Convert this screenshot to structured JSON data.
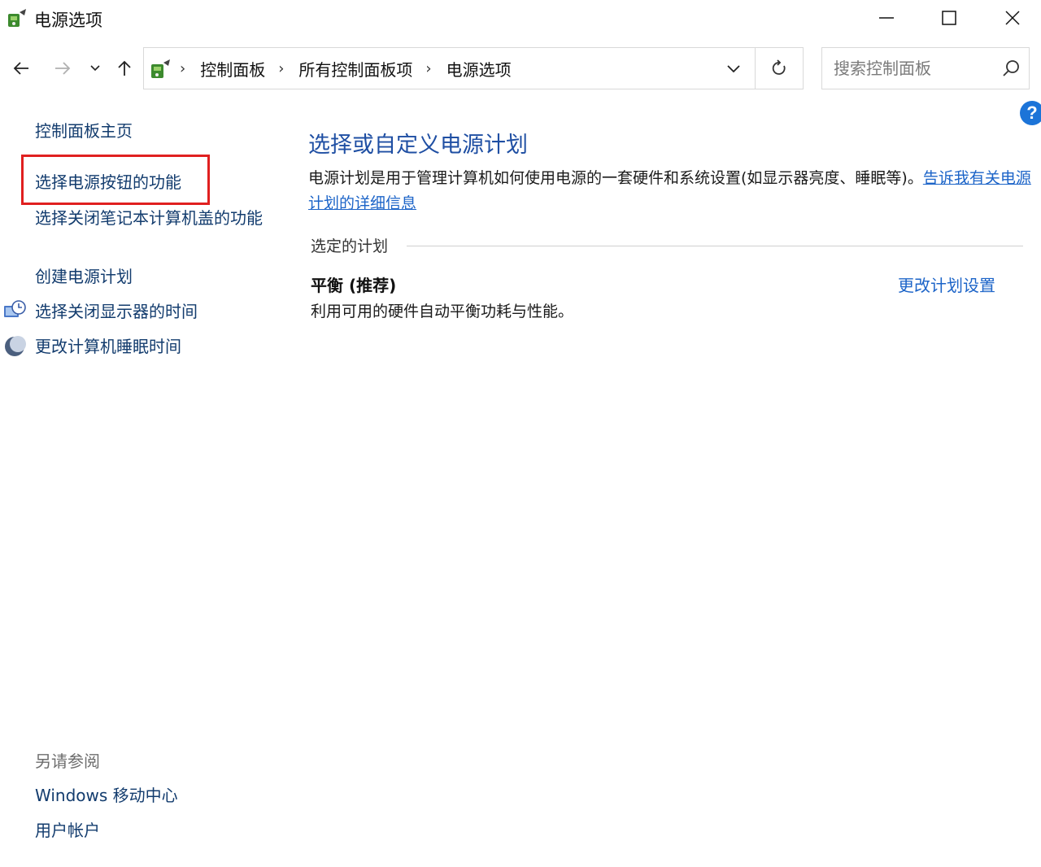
{
  "window": {
    "title": "电源选项"
  },
  "address": {
    "crumbs": [
      "控制面板",
      "所有控制面板项",
      "电源选项"
    ]
  },
  "search": {
    "placeholder": "搜索控制面板"
  },
  "sidebar": {
    "home": "控制面板主页",
    "items": [
      "选择电源按钮的功能",
      "选择关闭笔记本计算机盖的功能",
      "创建电源计划",
      "选择关闭显示器的时间",
      "更改计算机睡眠时间"
    ],
    "see_also_label": "另请参阅",
    "see_also": [
      "Windows 移动中心",
      "用户帐户"
    ]
  },
  "main": {
    "title": "选择或自定义电源计划",
    "description": "电源计划是用于管理计算机如何使用电源的一套硬件和系统设置(如显示器亮度、睡眠等)。",
    "description_link": "告诉我有关电源计划的详细信息",
    "section_label": "选定的计划",
    "plan_name": "平衡 (推荐)",
    "plan_description": "利用可用的硬件自动平衡功耗与性能。",
    "plan_change_link": "更改计划设置"
  },
  "colors": {
    "link": "#1c64c8",
    "heading": "#1f4fa3",
    "highlight": "#e02020"
  }
}
